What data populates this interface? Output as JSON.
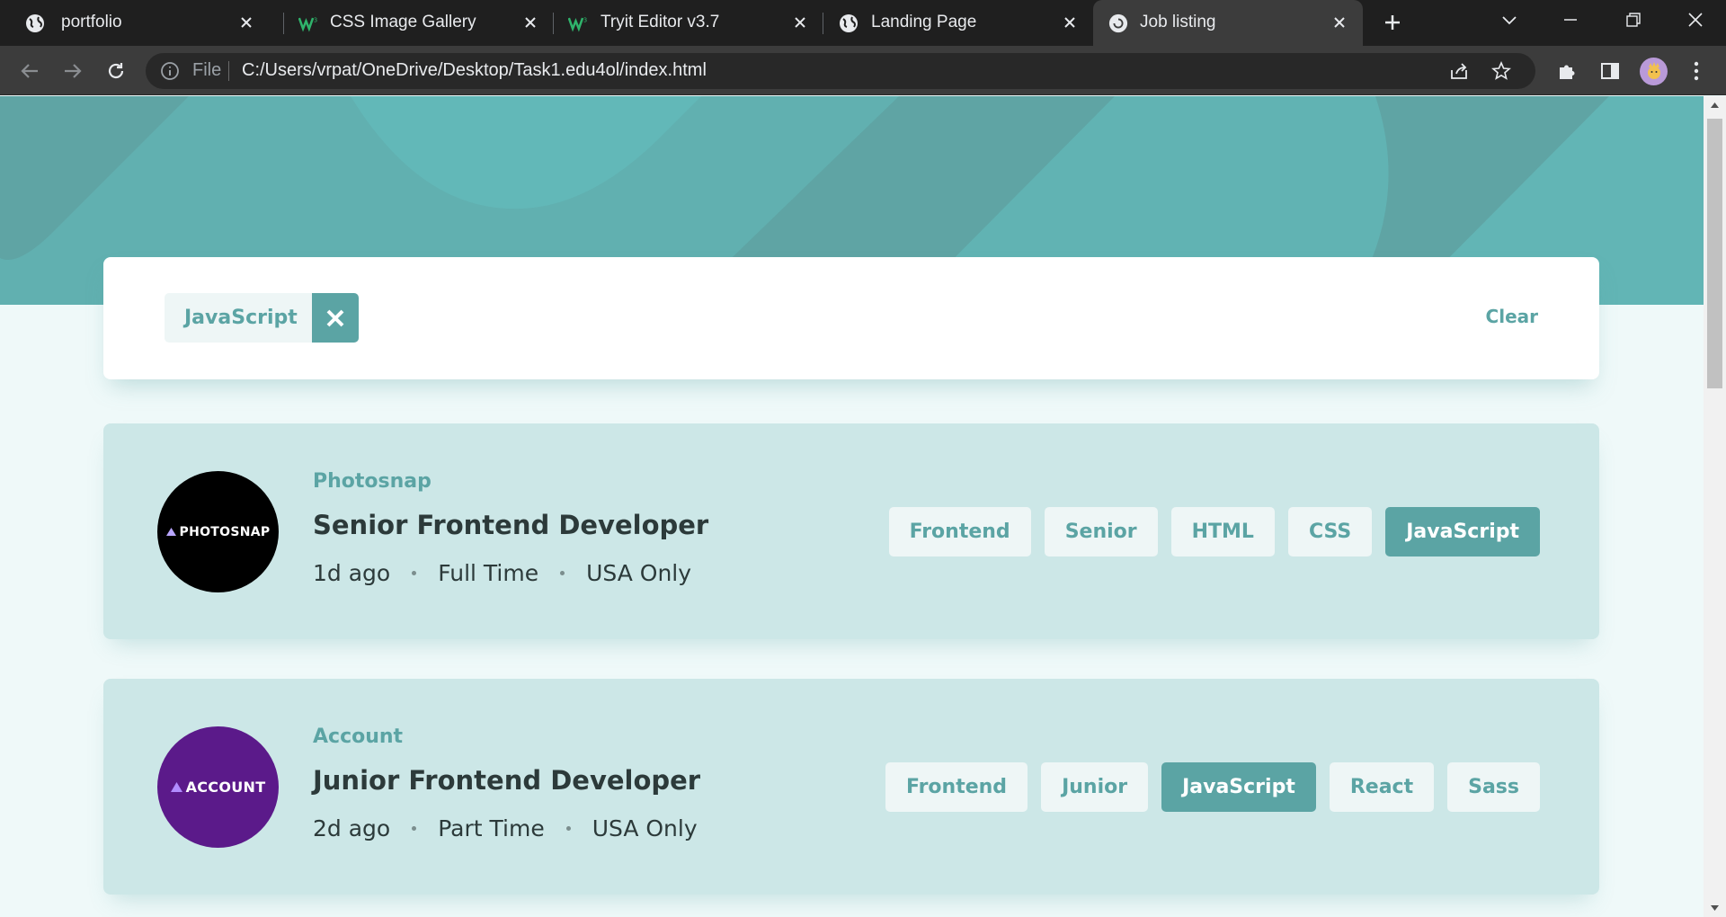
{
  "browser": {
    "tabs": [
      {
        "title": "portfolio",
        "icon": "globe-icon",
        "active": false
      },
      {
        "title": "CSS Image Gallery",
        "icon": "w3schools-icon",
        "active": false
      },
      {
        "title": "Tryit Editor v3.7",
        "icon": "w3schools-icon",
        "active": false
      },
      {
        "title": "Landing Page",
        "icon": "globe-icon",
        "active": false
      },
      {
        "title": "Job listing",
        "icon": "loading-icon",
        "active": true
      }
    ],
    "address": {
      "scheme_label": "File",
      "url": "C:/Users/vrpat/OneDrive/Desktop/Task1.edu4ol/index.html"
    }
  },
  "filter": {
    "chips": [
      {
        "label": "JavaScript"
      }
    ],
    "clear_label": "Clear"
  },
  "jobs": [
    {
      "company": "Photosnap",
      "logo_text": "PHOTOSNAP",
      "logo_color": "#000000",
      "position": "Senior Frontend Developer",
      "posted": "1d ago",
      "contract": "Full Time",
      "location": "USA Only",
      "tags": [
        {
          "label": "Frontend",
          "selected": false
        },
        {
          "label": "Senior",
          "selected": false
        },
        {
          "label": "HTML",
          "selected": false
        },
        {
          "label": "CSS",
          "selected": false
        },
        {
          "label": "JavaScript",
          "selected": true
        }
      ]
    },
    {
      "company": "Account",
      "logo_text": "ACCOUNT",
      "logo_color": "#5b1a8a",
      "position": "Junior Frontend Developer",
      "posted": "2d ago",
      "contract": "Part Time",
      "location": "USA Only",
      "tags": [
        {
          "label": "Frontend",
          "selected": false
        },
        {
          "label": "Junior",
          "selected": false
        },
        {
          "label": "JavaScript",
          "selected": true
        },
        {
          "label": "React",
          "selected": false
        },
        {
          "label": "Sass",
          "selected": false
        }
      ]
    }
  ],
  "colors": {
    "primary": "#5ba4a4",
    "header_bg": "#5fa4a4",
    "card_bg": "#cce7e7",
    "page_bg": "#eff9f9",
    "tag_bg": "#eef6f6"
  }
}
